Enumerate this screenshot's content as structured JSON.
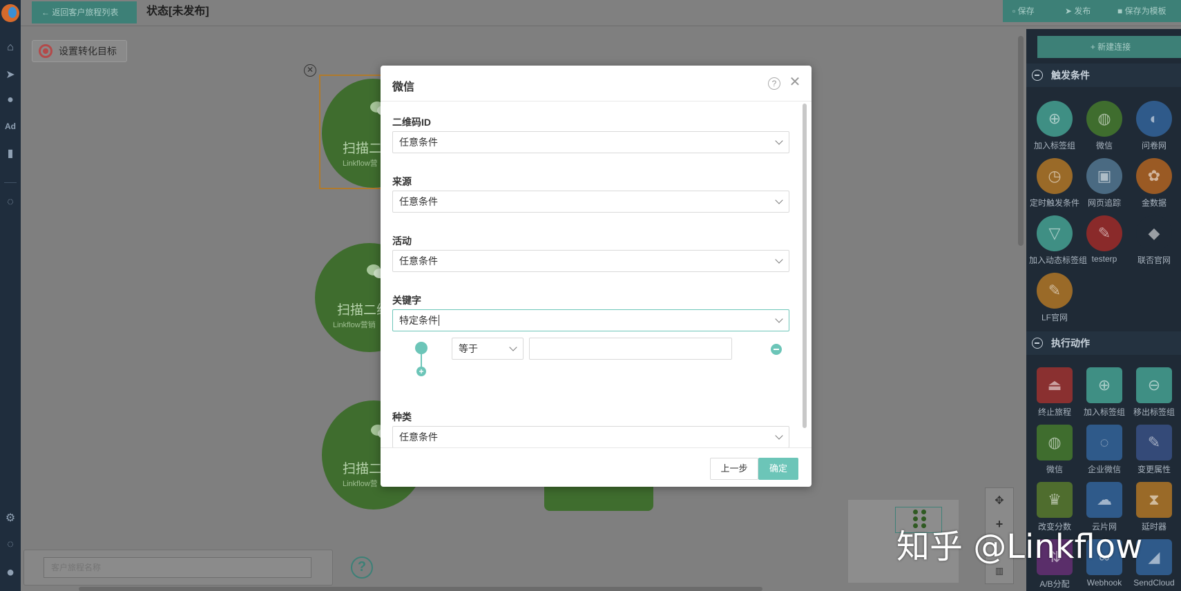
{
  "topbar": {
    "back_label": "← 返回客户旅程列表",
    "status_title": "状态[未发布]",
    "save_label": "保存",
    "publish_label": "发布",
    "save_template_label": "保存为模板"
  },
  "canvas": {
    "goal_button": "设置转化目标",
    "nodes": [
      {
        "title": "扫描二",
        "subtitle": "Linkflow营"
      },
      {
        "title": "扫描二维",
        "subtitle": "Linkflow营销"
      },
      {
        "title": "扫描二",
        "subtitle": "Linkflow营"
      }
    ],
    "journey_name_placeholder": "客户旅程名称"
  },
  "right_panel": {
    "new_connection": "+ 新建连接",
    "trigger_section": "触发条件",
    "triggers": [
      {
        "label": "加入标签组",
        "icon": "user-plus-icon",
        "color": "#3f8f84"
      },
      {
        "label": "微信",
        "icon": "wechat-icon",
        "color": "#3f6d2e"
      },
      {
        "label": "问卷网",
        "icon": "survey-icon",
        "color": "#2f5a8a"
      },
      {
        "label": "定时触发条件",
        "icon": "clock-icon",
        "color": "#9a6a28"
      },
      {
        "label": "网页追踪",
        "icon": "webpage-icon",
        "color": "#4a6a82"
      },
      {
        "label": "金数据",
        "icon": "plant-icon",
        "color": "#9a5a24"
      },
      {
        "label": "加入动态标签组",
        "icon": "user-filter-icon",
        "color": "#3f8f84"
      },
      {
        "label": "testerp",
        "icon": "wrench-icon",
        "color": "#8a2a2a"
      },
      {
        "label": "联否官网",
        "icon": "logo-icon",
        "color": "#1f2a36"
      },
      {
        "label": "LF官网",
        "icon": "wrench-icon",
        "color": "#9a6a28"
      }
    ],
    "action_section": "执行动作",
    "actions": [
      {
        "label": "终止旅程",
        "icon": "stop-icon",
        "color": "#8a3030"
      },
      {
        "label": "加入标签组",
        "icon": "user-plus-icon",
        "color": "#3f8f84"
      },
      {
        "label": "移出标签组",
        "icon": "user-minus-icon",
        "color": "#3f8f84"
      },
      {
        "label": "微信",
        "icon": "wechat-icon",
        "color": "#3f6d2e"
      },
      {
        "label": "企业微信",
        "icon": "work-wechat-icon",
        "color": "#2f5a8a"
      },
      {
        "label": "变更属性",
        "icon": "edit-icon",
        "color": "#344a78"
      },
      {
        "label": "改变分数",
        "icon": "trophy-icon",
        "color": "#4f6d2e"
      },
      {
        "label": "云片网",
        "icon": "cloud-icon",
        "color": "#2f5a8a"
      },
      {
        "label": "延时器",
        "icon": "hourglass-icon",
        "color": "#9a6a28"
      },
      {
        "label": "A/B分配",
        "icon": "split-icon",
        "color": "#5a2e6a"
      },
      {
        "label": "Webhook",
        "icon": "webhook-icon",
        "color": "#2f5a8a"
      },
      {
        "label": "SendCloud",
        "icon": "sendcloud-icon",
        "color": "#2f5a8a"
      }
    ]
  },
  "dialog": {
    "title": "微信",
    "fields": [
      {
        "label": "二维码ID",
        "value": "任意条件"
      },
      {
        "label": "来源",
        "value": "任意条件"
      },
      {
        "label": "活动",
        "value": "任意条件"
      },
      {
        "label": "关键字",
        "value": "特定条件"
      },
      {
        "label": "种类",
        "value": "任意条件"
      }
    ],
    "condition_operator": "等于",
    "condition_value": "",
    "prev_button": "上一步",
    "ok_button": "确定"
  },
  "watermark": "知乎 @Linkflow"
}
